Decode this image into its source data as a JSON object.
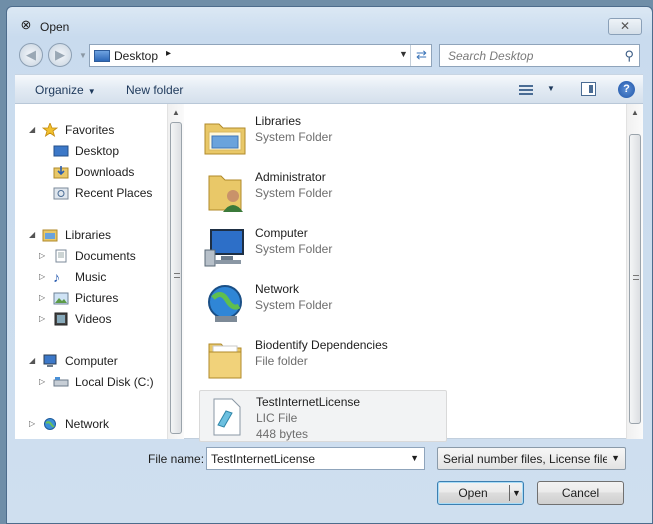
{
  "window": {
    "title": "Open",
    "close_label": "✕"
  },
  "address": {
    "location": "Desktop",
    "separator": "▸",
    "search_placeholder": "Search Desktop"
  },
  "toolbar": {
    "organize_label": "Organize",
    "new_folder_label": "New folder",
    "help_label": "?"
  },
  "nav_pane": {
    "items": [
      {
        "label": "Favorites",
        "icon": "star-icon"
      },
      {
        "label": "Desktop",
        "icon": "desktop-icon"
      },
      {
        "label": "Downloads",
        "icon": "downloads-icon"
      },
      {
        "label": "Recent Places",
        "icon": "recent-places-icon"
      },
      {
        "label": "Libraries",
        "icon": "libraries-icon"
      },
      {
        "label": "Documents",
        "icon": "documents-icon"
      },
      {
        "label": "Music",
        "icon": "music-icon"
      },
      {
        "label": "Pictures",
        "icon": "pictures-icon"
      },
      {
        "label": "Videos",
        "icon": "videos-icon"
      },
      {
        "label": "Computer",
        "icon": "computer-icon"
      },
      {
        "label": "Local Disk (C:)",
        "icon": "disk-icon"
      },
      {
        "label": "Network",
        "icon": "network-icon"
      }
    ]
  },
  "files": [
    {
      "name": "Libraries",
      "type": "System Folder",
      "icon": "libraries-folder-icon"
    },
    {
      "name": "Administrator",
      "type": "System Folder",
      "icon": "user-folder-icon"
    },
    {
      "name": "Computer",
      "type": "System Folder",
      "icon": "computer-icon"
    },
    {
      "name": "Network",
      "type": "System Folder",
      "icon": "network-globe-icon"
    },
    {
      "name": "Biodentify Dependencies",
      "type": "File folder",
      "icon": "folder-icon"
    },
    {
      "name": "TestInternetLicense",
      "type": "LIC File",
      "size": "448 bytes",
      "icon": "lic-file-icon"
    }
  ],
  "bottom": {
    "file_name_label": "File name:",
    "file_name_value": "TestInternetLicense",
    "filter_value": "Serial number files, License files",
    "open_label": "Open",
    "cancel_label": "Cancel"
  },
  "colors": {
    "accent": "#3c7fb1",
    "window_frame": "#4d6c8c",
    "selection": "#f2f3f4"
  }
}
